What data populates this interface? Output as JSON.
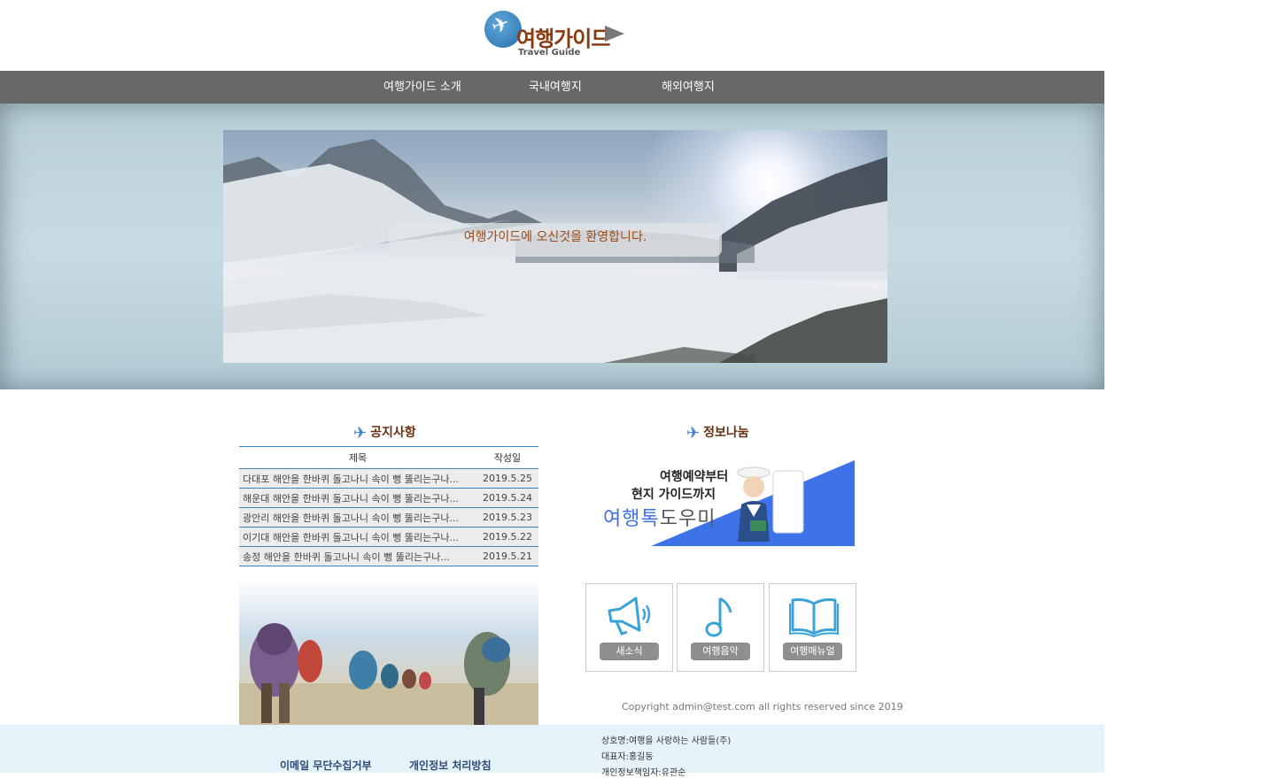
{
  "logo": {
    "title": "여행가이드",
    "subtitle": "Travel Guide"
  },
  "nav": {
    "items": [
      {
        "label": "여행가이드 소개"
      },
      {
        "label": "국내여행지"
      },
      {
        "label": "해외여행지"
      }
    ]
  },
  "hero": {
    "welcome": "여행가이드에 오신것을 환영합니다."
  },
  "notice": {
    "title": "공지사항",
    "columns": [
      "제목",
      "작성일"
    ],
    "rows": [
      {
        "title": "다대포 해안을 한바퀴 돌고나니 속이 뻥 뚫리는구나...",
        "date": "2019.5.25"
      },
      {
        "title": "해운대 해안을 한바퀴 돌고나니 속이 뻥 뚫리는구나...",
        "date": "2019.5.24"
      },
      {
        "title": "광안리 해안을 한바퀴 돌고나니 속이 뻥 뚫리는구나...",
        "date": "2019.5.23"
      },
      {
        "title": "이기대 해안을 한바퀴 돌고나니 속이 뻥 뚫리는구나...",
        "date": "2019.5.22"
      },
      {
        "title": "송정 해안을 한바퀴 돌고나니 속이 뻥 뚫리는구나...",
        "date": "2019.5.21"
      }
    ]
  },
  "info": {
    "title": "정보나눔",
    "banner_line1": "여행예약부터",
    "banner_line2": "현지 가이드까지",
    "banner_brand_a": "여행톡",
    "banner_brand_b": "도우미"
  },
  "quick": [
    {
      "label": "새소식",
      "icon": "megaphone-icon"
    },
    {
      "label": "여행음악",
      "icon": "music-note-icon"
    },
    {
      "label": "여행매뉴얼",
      "icon": "book-icon"
    }
  ],
  "copyright": "Copyright admin@test.com all rights reserved since 2019",
  "footer": {
    "links": [
      "이메일 무단수집거부",
      "개인정보 처리방침"
    ],
    "info": [
      "상호명:여행을 사랑하는 사람들(주)",
      "대표자:홍길동",
      "개인정보책임자:유관순"
    ]
  },
  "colors": {
    "nav_bg": "#686868",
    "accent_blue": "#3c86b8",
    "title_brown": "#6a2e10",
    "footer_bg": "#e6f2fa"
  }
}
